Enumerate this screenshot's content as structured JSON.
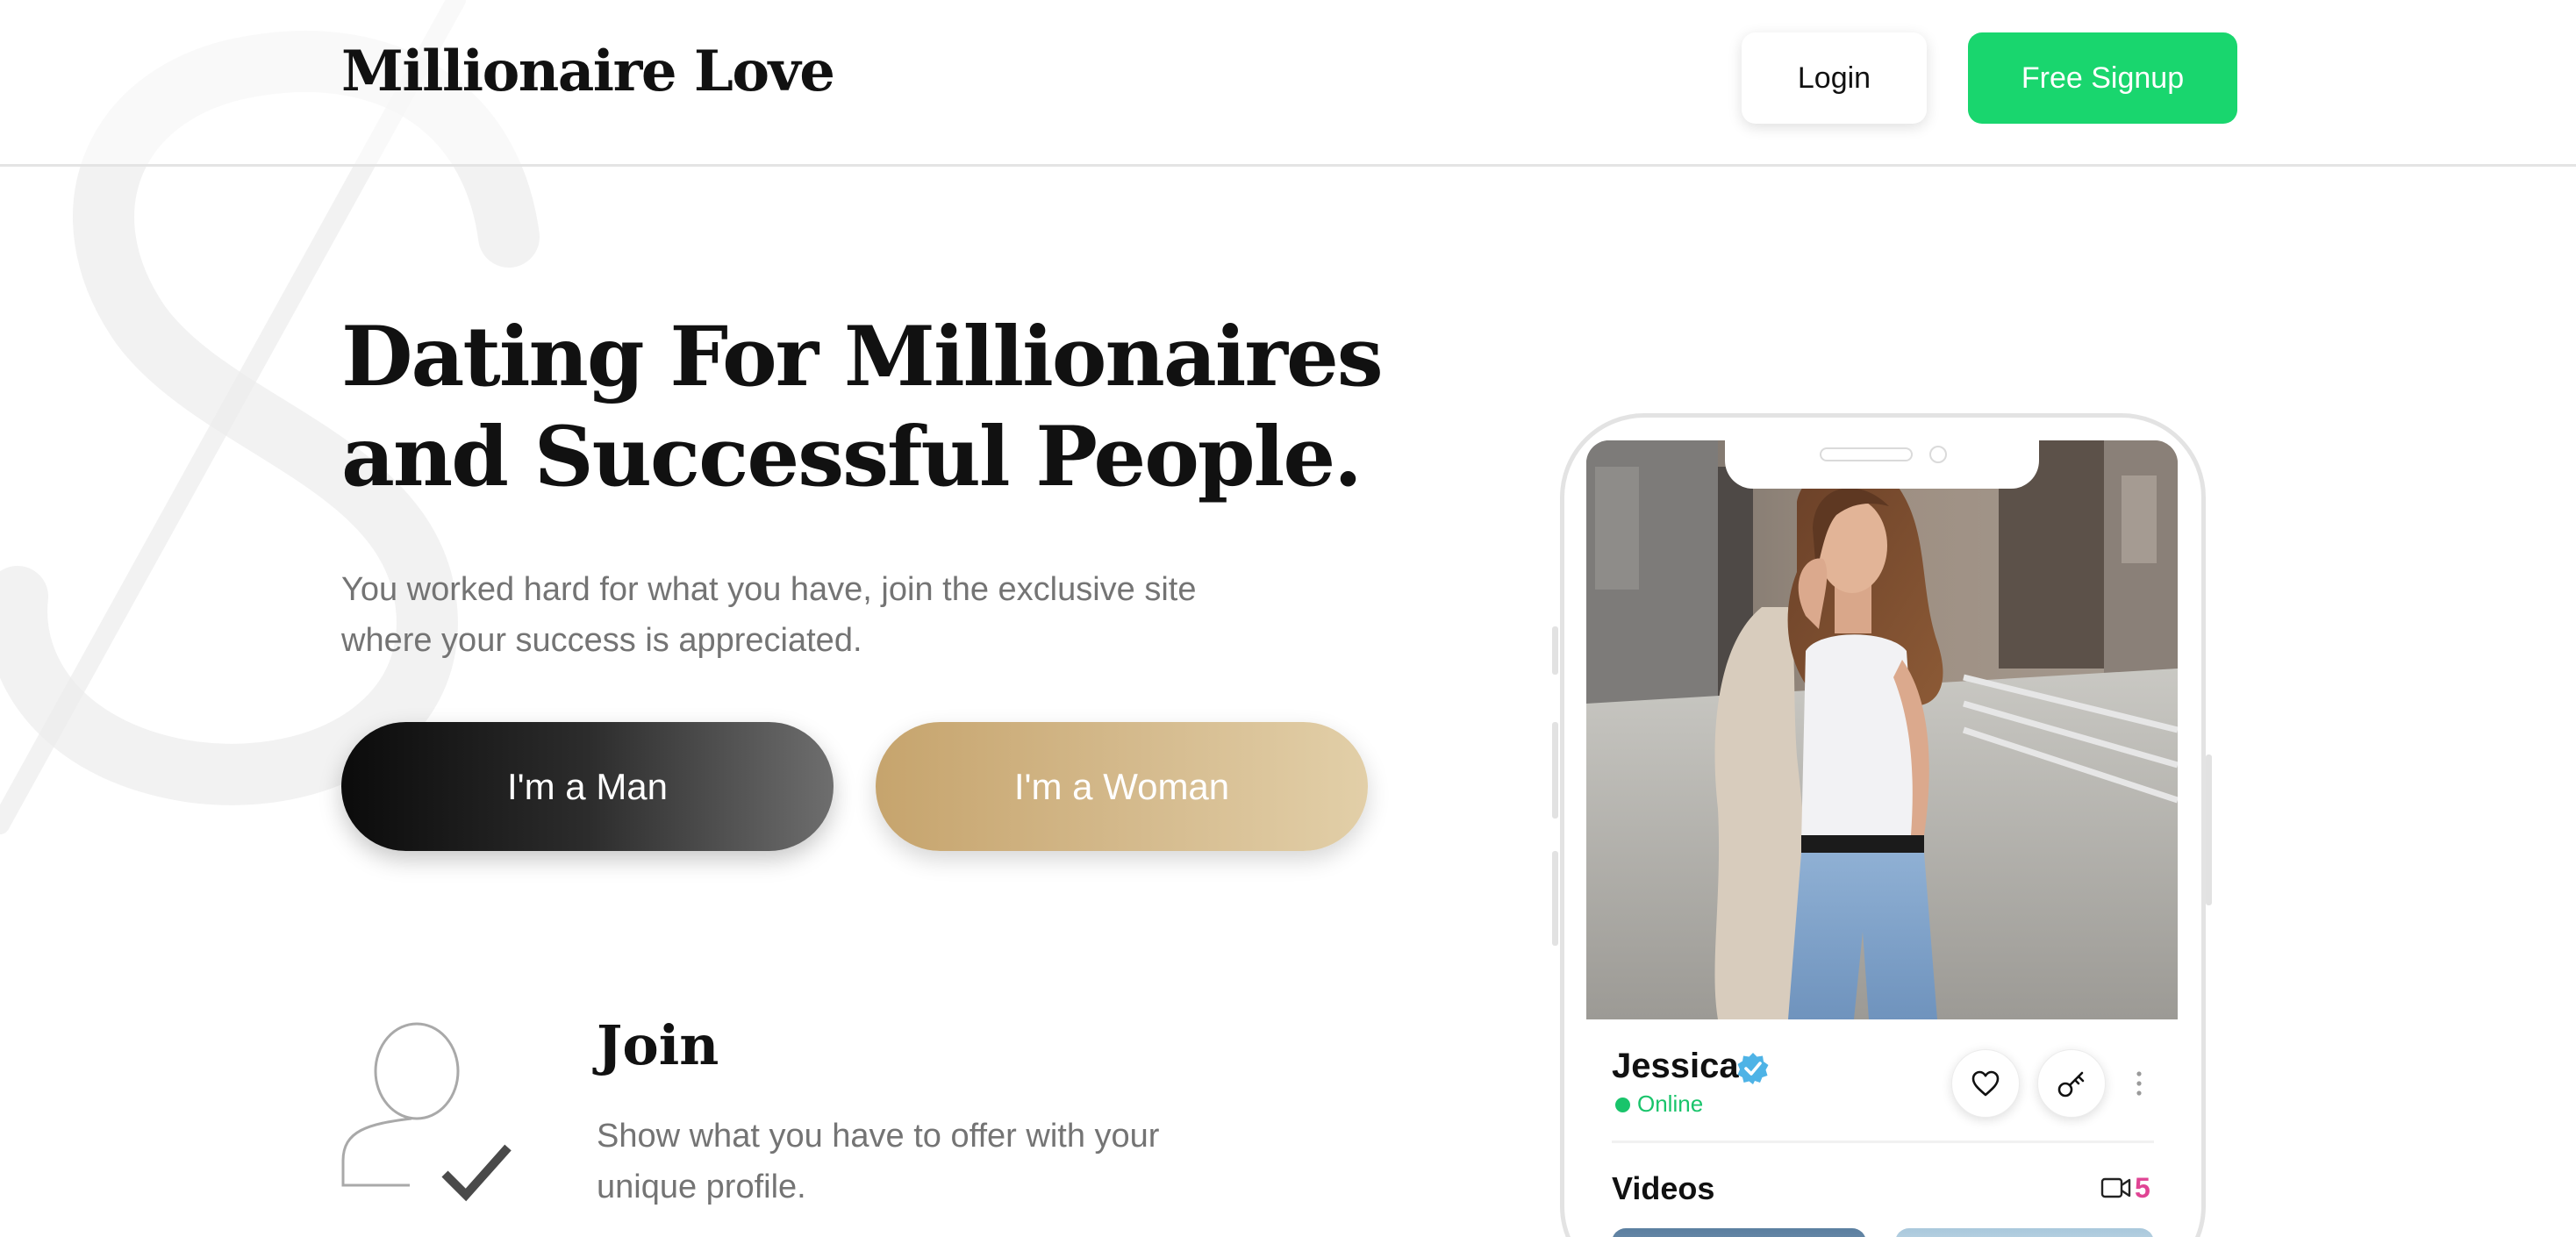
{
  "header": {
    "logo": "Millionaire Love",
    "login_label": "Login",
    "signup_label": "Free Signup"
  },
  "hero": {
    "title": "Dating For Millionaires and Successful People.",
    "subtitle": "You worked hard for what you have, join the exclusive site where your success is appreciated.",
    "man_button": "I'm a Man",
    "woman_button": "I'm a Woman"
  },
  "features": {
    "join_title": "Join",
    "join_text": "Show what you have to offer with your unique profile."
  },
  "phone": {
    "profile_name": "Jessica",
    "status": "Online",
    "videos_title": "Videos",
    "videos_count": "5"
  },
  "colors": {
    "signup_green": "#19d66e",
    "online_green": "#19c46b",
    "woman_gold": "#c6a46d",
    "verified_blue": "#4eb3e6",
    "count_pink": "#e04494"
  },
  "icons": {
    "watermark": "dollar-sign-watermark",
    "join": "user-check-icon",
    "verified": "verified-badge-icon",
    "like": "heart-icon",
    "key": "key-icon",
    "more": "more-vertical-icon",
    "video": "video-camera-icon"
  }
}
